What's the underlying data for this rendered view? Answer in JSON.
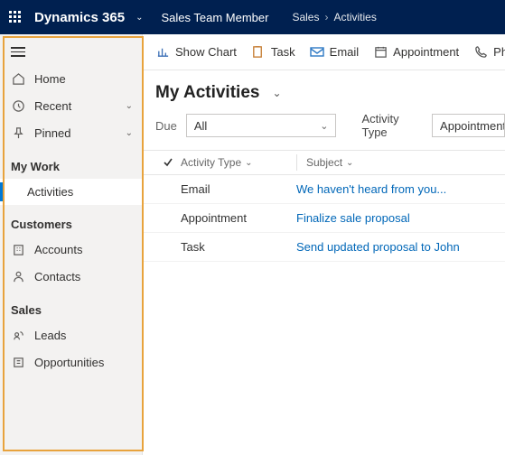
{
  "topbar": {
    "brand": "Dynamics 365",
    "product": "Sales Team Member",
    "crumbs": [
      "Sales",
      "Activities"
    ]
  },
  "sidebar": {
    "home": "Home",
    "recent": "Recent",
    "pinned": "Pinned",
    "sections": {
      "mywork": {
        "header": "My Work",
        "items": {
          "activities": "Activities"
        }
      },
      "customers": {
        "header": "Customers",
        "items": {
          "accounts": "Accounts",
          "contacts": "Contacts"
        }
      },
      "sales": {
        "header": "Sales",
        "items": {
          "leads": "Leads",
          "opportunities": "Opportunities"
        }
      }
    }
  },
  "commands": {
    "showchart": "Show Chart",
    "task": "Task",
    "email": "Email",
    "appointment": "Appointment",
    "phonecall": "Phone Call"
  },
  "page": {
    "title": "My Activities",
    "filters": {
      "due_label": "Due",
      "due_value": "All",
      "atype_label": "Activity Type",
      "atype_value": "Appointment,C"
    }
  },
  "grid": {
    "headers": {
      "atype": "Activity Type",
      "subject": "Subject"
    },
    "rows": [
      {
        "atype": "Email",
        "subject": "We haven't heard from you..."
      },
      {
        "atype": "Appointment",
        "subject": "Finalize sale proposal"
      },
      {
        "atype": "Task",
        "subject": "Send updated proposal to John"
      }
    ]
  }
}
